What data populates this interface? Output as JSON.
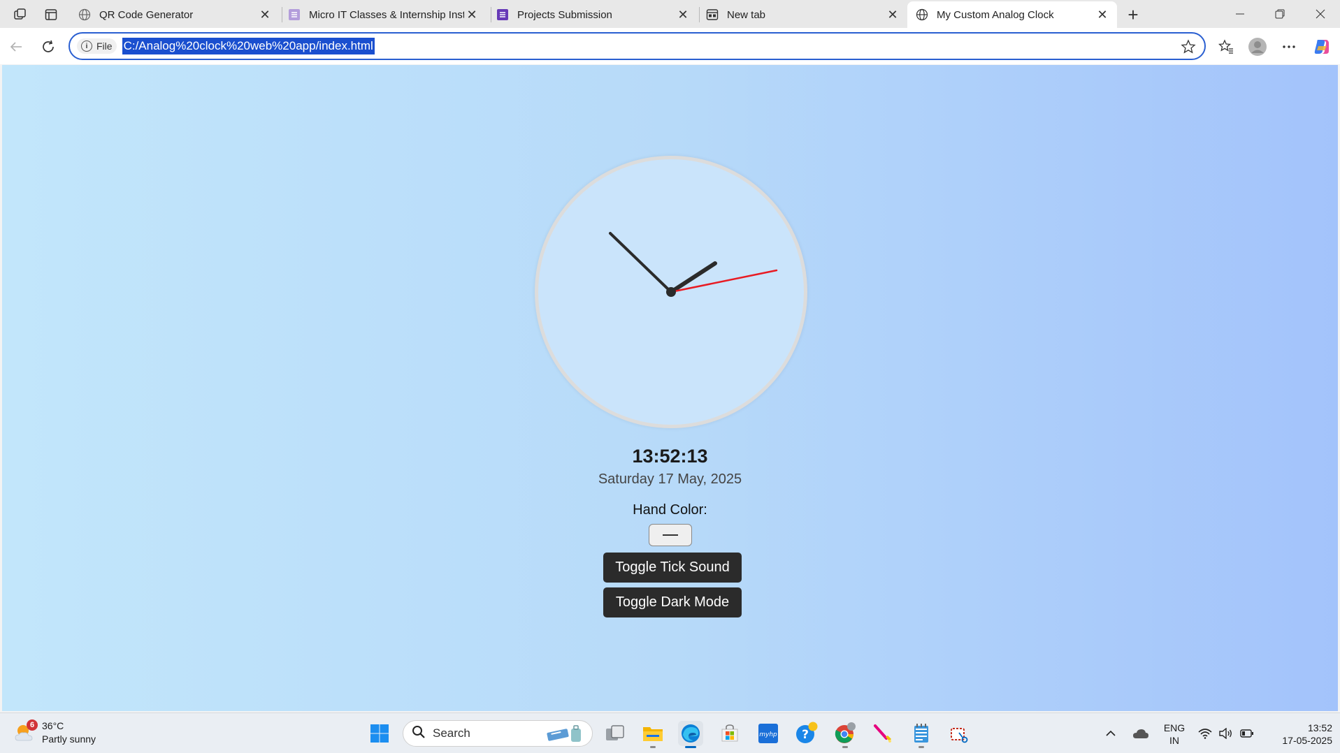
{
  "tabs": [
    {
      "label": "QR Code Generator",
      "active": false
    },
    {
      "label": "Micro IT Classes & Internship Inst",
      "active": false
    },
    {
      "label": "Projects Submission",
      "active": false
    },
    {
      "label": "New tab",
      "active": false
    },
    {
      "label": "My Custom Analog Clock",
      "active": true
    }
  ],
  "address": {
    "chip": "File",
    "url": "C:/Analog%20clock%20web%20app/index.html"
  },
  "page": {
    "time": "13:52:13",
    "date": "Saturday 17 May, 2025",
    "hand_color_label": "Hand Color:",
    "toggle_tick_label": "Toggle Tick Sound",
    "toggle_dark_label": "Toggle Dark Mode"
  },
  "colors": {
    "hand": "#2b2b2b",
    "second_hand": "#e81b23",
    "button_bg": "#2b2b2b",
    "accent": "#1a4fcf"
  },
  "taskbar": {
    "weather_badge": "6",
    "weather_temp": "36°C",
    "weather_desc": "Partly sunny",
    "search_label": "Search",
    "lang_line1": "ENG",
    "lang_line2": "IN",
    "clock_time": "13:52",
    "clock_date": "17-05-2025",
    "apps": [
      "windows-start-icon",
      "search",
      "task-view-icon",
      "file-explorer-icon",
      "edge-icon",
      "store-icon",
      "myhp-icon",
      "help-icon",
      "chrome-icon",
      "paint-icon",
      "notepad-icon",
      "snipping-tool-icon"
    ]
  }
}
